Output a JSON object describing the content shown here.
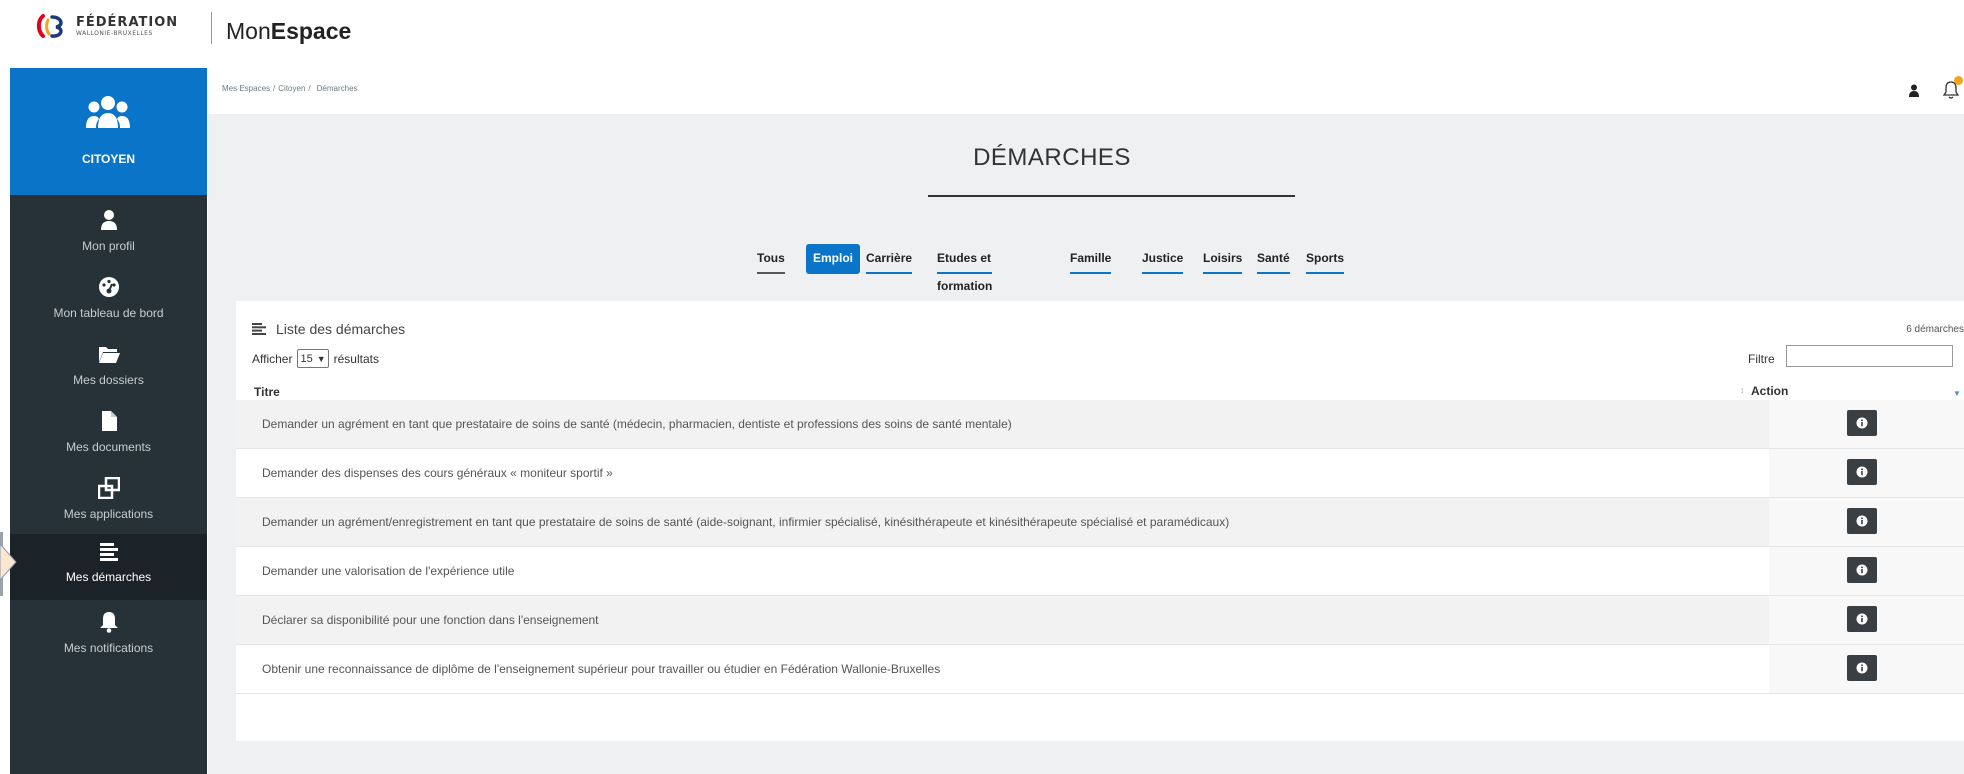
{
  "header": {
    "logo_line1": "FÉDÉRATION",
    "logo_line2": "WALLONIE-BRUXELLES",
    "app_title_prefix": "Mon",
    "app_title_suffix": "Espace"
  },
  "sidebar": {
    "space_label": "CITOYEN",
    "items": [
      {
        "label": "Mon profil",
        "icon": "user-icon"
      },
      {
        "label": "Mon tableau de bord",
        "icon": "dashboard-icon"
      },
      {
        "label": "Mes dossiers",
        "icon": "folder-icon"
      },
      {
        "label": "Mes documents",
        "icon": "document-icon"
      },
      {
        "label": "Mes applications",
        "icon": "applications-icon"
      },
      {
        "label": "Mes démarches",
        "icon": "list-icon",
        "active": true
      },
      {
        "label": "Mes notifications",
        "icon": "bell-icon"
      }
    ]
  },
  "breadcrumb": [
    "Mes Espaces",
    "Citoyen",
    "Démarches"
  ],
  "breadcrumb_separator": "/",
  "page_title": "DÉMARCHES",
  "filters": [
    "Tous",
    "Emploi",
    "Carrière",
    "Etudes et formation",
    "Famille",
    "Justice",
    "Loisirs",
    "Santé",
    "Sports"
  ],
  "active_filter": "Emploi",
  "panel": {
    "title": "Liste des démarches",
    "count": "6 démarches",
    "show_prefix": "Afficher",
    "show_value": "15",
    "show_suffix": "résultats",
    "filter_label": "Filtre",
    "filter_value": "",
    "columns": {
      "title": "Titre",
      "action": "Action"
    }
  },
  "rows": [
    {
      "title": "Demander un agrément en tant que prestataire de soins de santé (médecin, pharmacien, dentiste et professions des soins de santé mentale)"
    },
    {
      "title": "Demander des dispenses des cours généraux « moniteur sportif »"
    },
    {
      "title": "Demander un agrément/enregistrement en tant que prestataire de soins de santé (aide-soignant, infirmier spécialisé, kinésithérapeute et kinésithérapeute spécialisé et paramédicaux)"
    },
    {
      "title": "Demander une valorisation de l'expérience utile"
    },
    {
      "title": "Déclarer sa disponibilité pour une fonction dans l'enseignement"
    },
    {
      "title": "Obtenir une reconnaissance de diplôme de l'enseignement supérieur pour travailler ou étudier en Fédération Wallonie-Bruxelles"
    }
  ],
  "colors": {
    "brand_blue": "#0a74c8",
    "sidebar_bg": "#263238",
    "page_bg": "#eef0f2",
    "badge": "#f2a51a"
  }
}
